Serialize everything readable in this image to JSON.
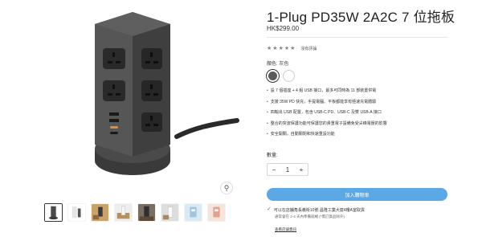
{
  "product": {
    "title": "1-Plug PD35W 2A2C 7 位拖板",
    "price": "HK$299.00",
    "rating_link": "沒有評論",
    "color_label": "顏色: 灰色",
    "colors": [
      "#5a5a5a",
      "#ffffff"
    ],
    "features": [
      "設 7 個插座 + 4 組 USB 接口，最多可同時為 11 部裝置供電",
      "支援 35W PD 快充，手提電腦、平板都能享有極速充電體驗",
      "四輸出 USB 配置，包含 USB-C PD、USB-C 及雙 USB-A 接口",
      "整合的突波保護功能可保護您的貴重電子設備免受尖峰電壓的影響",
      "安全開關，自動關閉和快速重設功能"
    ],
    "quantity_label": "數量:",
    "quantity": "1",
    "add_to_cart": "加入購物車",
    "pickup_text": "可以在店舖角長義街10號 昌隆工業大廈4樓A室取貨",
    "pickup_sub": "通常會在 2-4 天內準備就緒 (*需訂貨品除外)",
    "store_link": "查看店舖資訊"
  },
  "icons": {
    "zoom": "magnifier-icon",
    "check": "check-icon",
    "star": "star-icon"
  }
}
